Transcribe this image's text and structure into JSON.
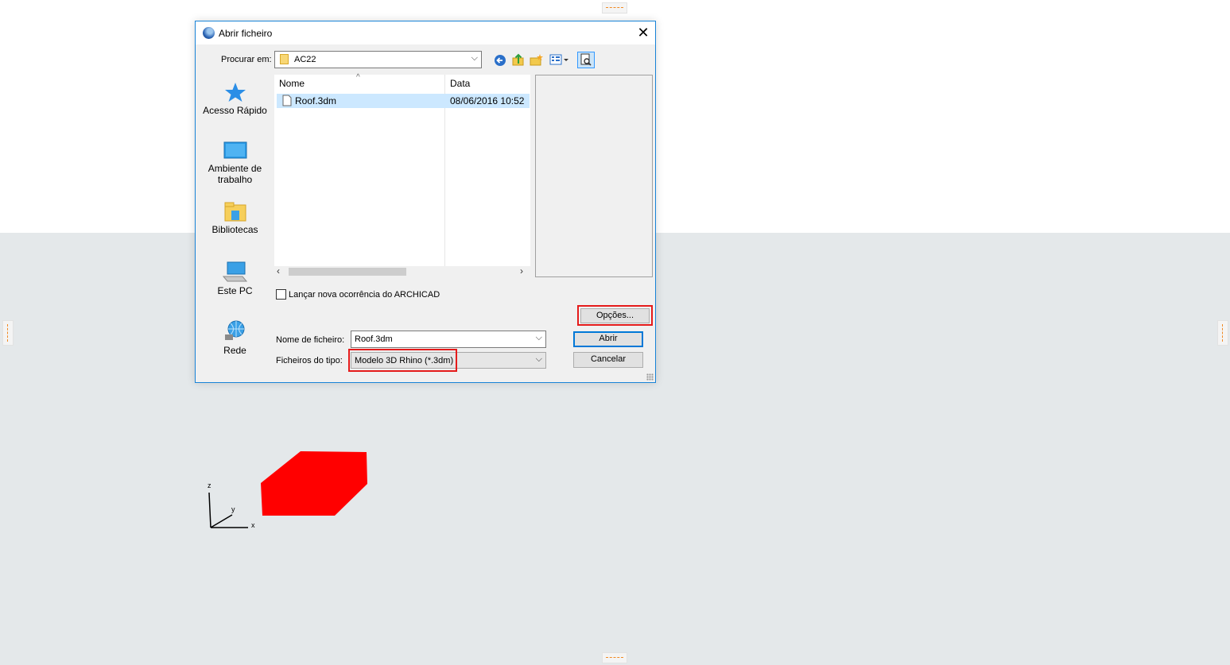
{
  "dialog": {
    "title": "Abrir ficheiro",
    "close_symbol": "✕",
    "look_in": {
      "label": "Procurar em:",
      "value": "AC22"
    },
    "toolbar_icons": [
      "back-icon",
      "up-folder-icon",
      "new-folder-icon",
      "view-menu-icon",
      "preview-icon"
    ],
    "places": [
      {
        "label": "Acesso Rápido",
        "icon": "star-icon"
      },
      {
        "label": "Ambiente de trabalho",
        "icon": "desktop-icon"
      },
      {
        "label": "Bibliotecas",
        "icon": "libraries-icon"
      },
      {
        "label": "Este PC",
        "icon": "computer-icon"
      },
      {
        "label": "Rede",
        "icon": "network-icon"
      }
    ],
    "columns": [
      "Nome",
      "Data"
    ],
    "files": [
      {
        "name": "Roof.3dm",
        "date": "08/06/2016 10:52",
        "selected": true
      }
    ],
    "new_instance_checkbox": {
      "label": "Lançar nova ocorrência do ARCHICAD",
      "checked": false
    },
    "options_button": "Opções...",
    "file_name": {
      "label": "Nome de ficheiro:",
      "value": "Roof.3dm"
    },
    "file_type": {
      "label": "Ficheiros do tipo:",
      "value": "Modelo 3D Rhino (*.3dm)"
    },
    "open_button": "Abrir",
    "cancel_button": "Cancelar"
  },
  "viewport": {
    "axes": {
      "x": "x",
      "y": "y",
      "z": "z"
    },
    "object_color": "#ff0000",
    "background_color": "#e4e8ea"
  },
  "colors": {
    "highlight": "#e51b1b",
    "accent": "#0078d7",
    "selection": "#cce8ff"
  }
}
